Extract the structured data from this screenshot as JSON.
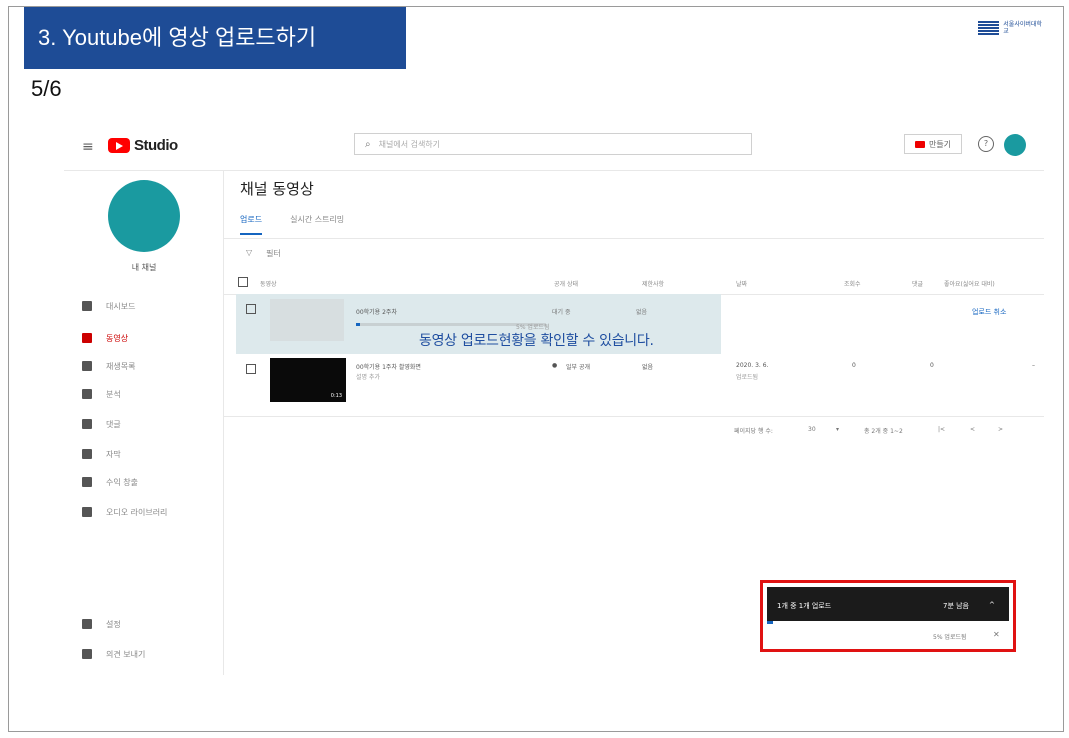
{
  "slide": {
    "title": "3. Youtube에 영상 업로드하기",
    "page": "5/6",
    "logo_text": "서울사이버대학교"
  },
  "studio": {
    "brand": "Studio",
    "search_placeholder": "채널에서 검색하기",
    "create_label": "만들기",
    "help_symbol": "?",
    "menu_symbol": "≡",
    "search_symbol": "⌕",
    "sidebar": {
      "channel_name": "내 채널",
      "items": [
        {
          "label": "대시보드",
          "icon": "dashboard-icon",
          "active": false
        },
        {
          "label": "동영상",
          "icon": "video-icon",
          "active": true
        },
        {
          "label": "재생목록",
          "icon": "playlist-icon",
          "active": false
        },
        {
          "label": "분석",
          "icon": "analytics-icon",
          "active": false
        },
        {
          "label": "댓글",
          "icon": "comments-icon",
          "active": false
        },
        {
          "label": "자막",
          "icon": "subtitles-icon",
          "active": false
        },
        {
          "label": "수익 창출",
          "icon": "monetization-icon",
          "active": false
        },
        {
          "label": "오디오 라이브러리",
          "icon": "audio-library-icon",
          "active": false
        }
      ],
      "bottom_items": [
        {
          "label": "설정",
          "icon": "settings-icon"
        },
        {
          "label": "의견 보내기",
          "icon": "feedback-icon"
        }
      ]
    },
    "main": {
      "title": "채널 동영상",
      "tabs": [
        "업로드",
        "실시간 스트리밍"
      ],
      "filter_label": "필터",
      "columns": [
        "동영상",
        "공개 상태",
        "제한사항",
        "날짜",
        "조회수",
        "댓글",
        "좋아요(싫어요 대비)"
      ],
      "uploading_row": {
        "title": "00학기용 2주차",
        "status": "대기 중",
        "restriction": "없음",
        "percent": "5% 업로드됨",
        "cancel": "업로드 취소"
      },
      "published_row": {
        "title": "00학기용 1주차 촬영화면",
        "subtitle": "설명 추가",
        "duration": "0:13",
        "visibility": "일부 공개",
        "restriction": "없음",
        "date": "2020. 3. 6.",
        "date_sub": "업로드됨",
        "views": "0",
        "comments": "0",
        "likes": "–"
      },
      "pager": {
        "rows_label": "페이지당 행 수:",
        "rows_value": "30",
        "range": "총 2개 중 1~2",
        "first": "|<",
        "prev": "<",
        "next": ">"
      }
    },
    "annotation": "동영상 업로드현황을 확인할 수 있습니다.",
    "upload_panel": {
      "title": "1개 중 1개 업로드",
      "remaining": "7분 남음",
      "progress_text": "5% 업로드됨",
      "progress_fraction": 0.05,
      "expand_symbol": "^",
      "close_symbol": "✕"
    }
  }
}
